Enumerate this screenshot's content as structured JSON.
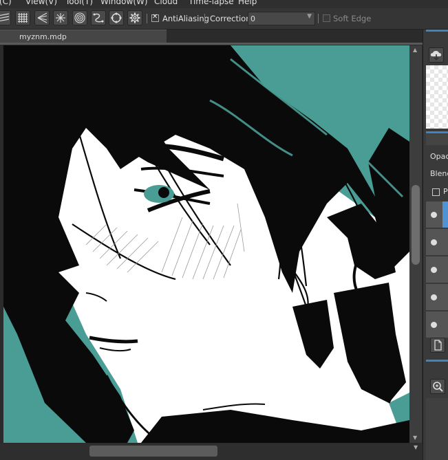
{
  "menu": {
    "items": [
      "r(C)",
      "View(V)",
      "Tool(T)",
      "Window(W)",
      "Cloud",
      "Time-lapse",
      "Help"
    ]
  },
  "toolbar": {
    "tools": [
      "parallel-ruler-icon",
      "grid-icon",
      "perspective-ruler-icon",
      "radial-ruler-icon",
      "concentric-circle-icon",
      "curve-ruler-icon",
      "ellipse-ruler-icon",
      "gear-icon"
    ],
    "antialiasing_label": "AntiAliasing",
    "antialiasing_checked": true,
    "correction_label": "Correction",
    "correction_value": "0",
    "soft_edge_label": "Soft Edge",
    "soft_edge_checked": false
  },
  "document": {
    "tab_label": "myznm.mdp"
  },
  "right_panel": {
    "opacity_label": "Opaci",
    "blend_label": "Blend",
    "protect_label": "P",
    "layers": 5
  },
  "colors": {
    "teal": "#4a9d94",
    "ink": "#0a0a0a",
    "accent_blue": "#3d86c6"
  }
}
